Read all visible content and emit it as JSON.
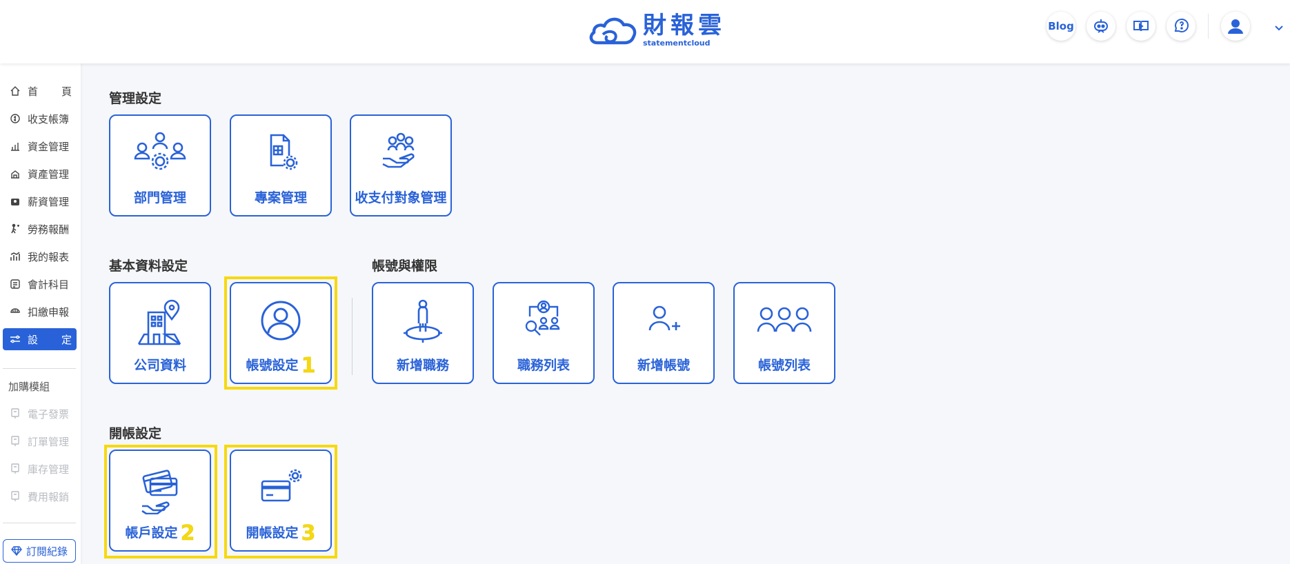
{
  "header": {
    "logo_main": "財報雲",
    "logo_sub": "statementcloud",
    "blog_label": "Blog"
  },
  "sidebar": {
    "items": [
      {
        "label_a": "首",
        "label_b": "頁",
        "icon": "home-icon"
      },
      {
        "label": "收支帳簿",
        "icon": "ledger-icon"
      },
      {
        "label": "資金管理",
        "icon": "funds-icon"
      },
      {
        "label": "資產管理",
        "icon": "asset-icon"
      },
      {
        "label": "薪資管理",
        "icon": "payroll-icon"
      },
      {
        "label": "勞務報酬",
        "icon": "service-fee-icon"
      },
      {
        "label": "我的報表",
        "icon": "report-icon"
      },
      {
        "label": "會計科目",
        "icon": "accounts-icon"
      },
      {
        "label": "扣繳申報",
        "icon": "withholding-icon"
      },
      {
        "label_a": "設",
        "label_b": "定",
        "icon": "settings-sliders-icon"
      }
    ],
    "group_title": "加購模組",
    "addons": [
      {
        "label": "電子發票"
      },
      {
        "label": "訂單管理"
      },
      {
        "label": "庫存管理"
      },
      {
        "label": "費用報銷"
      }
    ],
    "subscription_label": "訂閱紀錄"
  },
  "sections": {
    "management": {
      "title": "管理設定",
      "cards": [
        {
          "label": "部門管理",
          "icon": "department-icon"
        },
        {
          "label": "專案管理",
          "icon": "project-icon"
        },
        {
          "label": "收支付對象管理",
          "icon": "counterparty-icon"
        }
      ]
    },
    "basic": {
      "title": "基本資料設定",
      "cards": [
        {
          "label": "公司資料",
          "icon": "company-building-icon"
        },
        {
          "label": "帳號設定",
          "icon": "account-user-icon",
          "badge": "1"
        }
      ]
    },
    "accounts": {
      "title": "帳號與權限",
      "cards": [
        {
          "label": "新增職務",
          "icon": "add-role-icon"
        },
        {
          "label": "職務列表",
          "icon": "role-list-icon"
        },
        {
          "label": "新增帳號",
          "icon": "add-account-icon"
        },
        {
          "label": "帳號列表",
          "icon": "account-list-icon"
        }
      ]
    },
    "opening": {
      "title": "開帳設定",
      "cards": [
        {
          "label": "帳戶設定",
          "icon": "bank-account-icon",
          "badge": "2"
        },
        {
          "label": "開帳設定",
          "icon": "opening-balance-icon",
          "badge": "3"
        }
      ]
    }
  },
  "colors": {
    "primary": "#2962d8",
    "highlight": "#f6d90f",
    "background": "#f5f7fa"
  }
}
